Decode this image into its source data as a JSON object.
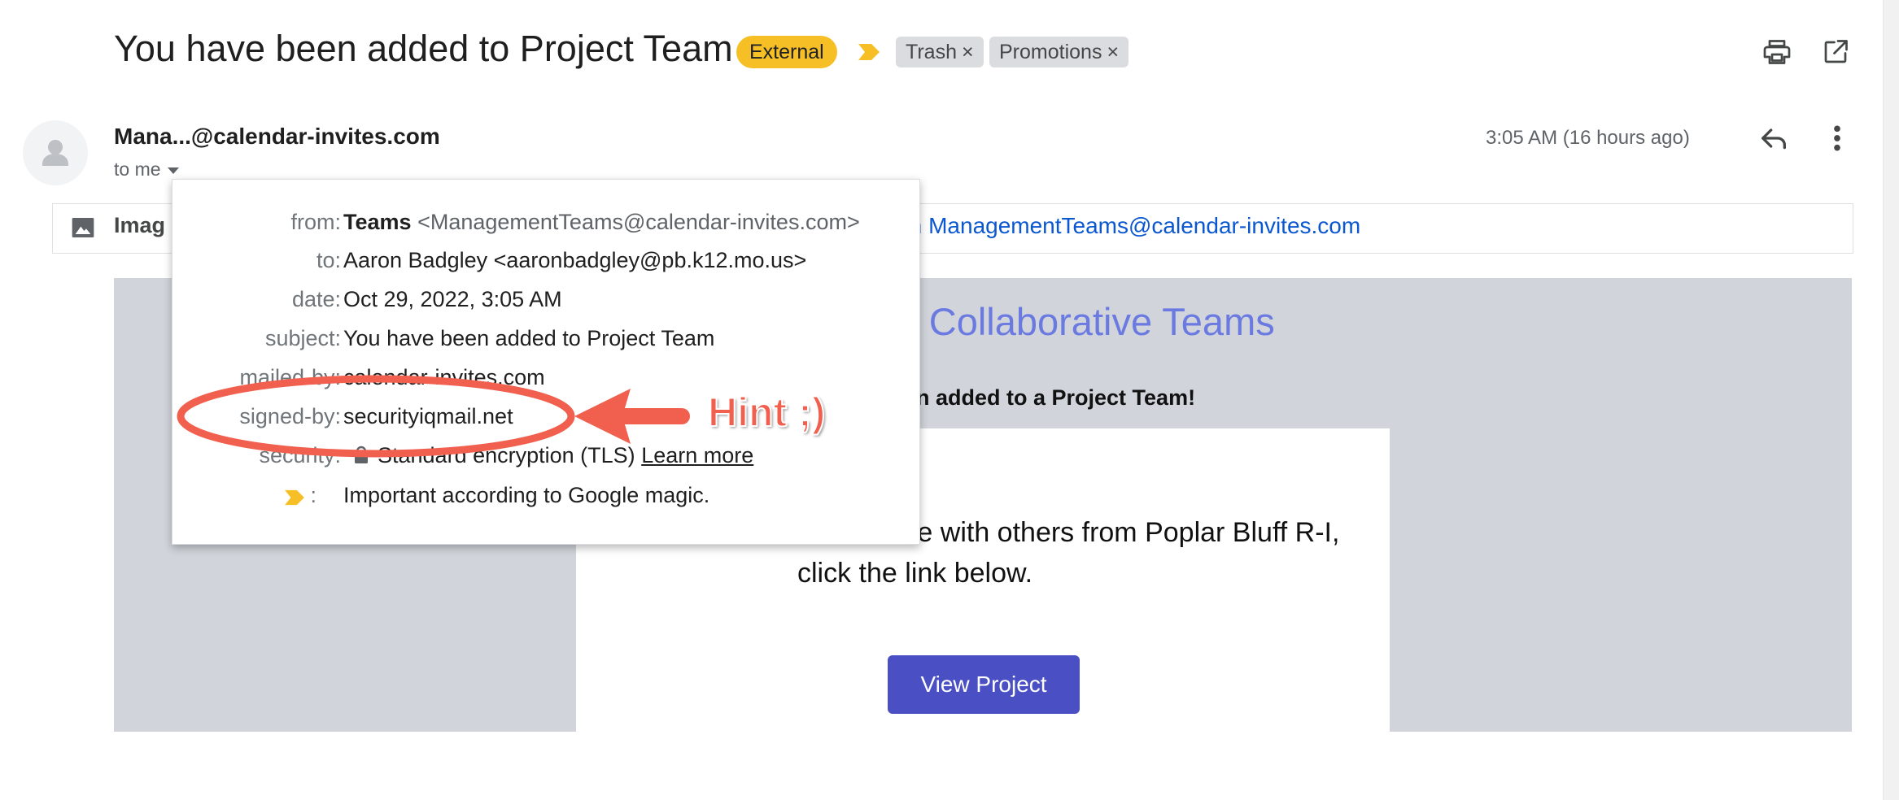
{
  "header": {
    "subject": "You have been added to Project Team",
    "external_chip": "External",
    "labels": [
      "Trash",
      "Promotions"
    ],
    "label_close": "×",
    "icons": [
      "printer-icon",
      "open-in-new-window-icon"
    ]
  },
  "sender": {
    "name": "Mana...@calendar-invites.com",
    "to_me": "to me",
    "timestamp": "3:05 AM (16 hours ago)"
  },
  "image_banner": {
    "text": "Imag",
    "link_text": "m ManagementTeams@calendar-invites.com"
  },
  "details_popup": {
    "from_label": "from:",
    "from_name": "Teams",
    "from_addr": "<ManagementTeams@calendar-invites.com>",
    "to_label": "to:",
    "to_value": "Aaron Badgley <aaronbadgley@pb.k12.mo.us>",
    "date_label": "date:",
    "date_value": "Oct 29, 2022, 3:05 AM",
    "subject_label": "subject:",
    "subject_value": "You have been added to Project Team",
    "mailedby_label": "mailed-by:",
    "mailedby_value": "calendar-invites.com",
    "signedby_label": "signed-by:",
    "signedby_value": "securityiqmail.net",
    "security_label": "security:",
    "security_value": "Standard encryption (TLS)",
    "security_link": "Learn more",
    "importance_sep": ":",
    "importance_value": "Important according to Google magic."
  },
  "annotation": {
    "hint": "Hint ;)",
    "color": "#f1604f"
  },
  "email_body": {
    "title": "-I Collaborative Teams",
    "subtitle": "n added to a Project Team!",
    "paragraph": "collaborate with others from Poplar Bluff R-I, click the link below.",
    "button": "View Project"
  },
  "colors": {
    "external_chip": "#f6bf26",
    "label_chip": "#dadce0",
    "body_background": "#d1d5db",
    "title_color": "#6b7ae0",
    "button": "#4a4fc4",
    "link": "#0b57d0"
  }
}
